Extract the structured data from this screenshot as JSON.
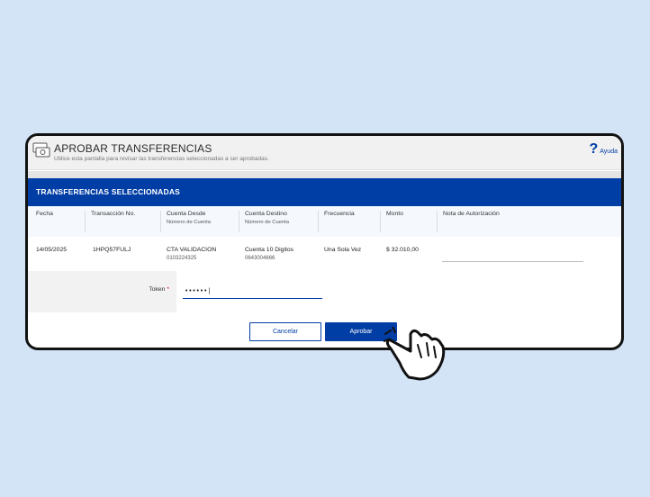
{
  "header": {
    "title": "APROBAR TRANSFERENCIAS",
    "subtitle": "Utilice esta pantalla para revisar las transferencias seleccionadas a ser aprobadas.",
    "help_label": "Ayuda",
    "icon": "money-transfer-icon"
  },
  "section": {
    "title": "TRANSFERENCIAS SELECCIONADAS"
  },
  "table": {
    "columns": [
      {
        "label": "Fecha"
      },
      {
        "label": "Transacción No."
      },
      {
        "label": "Cuenta Desde",
        "sub": "Número de Cuenta"
      },
      {
        "label": "Cuenta Destino",
        "sub": "Número de Cuenta"
      },
      {
        "label": "Frecuencia"
      },
      {
        "label": "Monto"
      },
      {
        "label": "Nota de Autorización"
      }
    ],
    "rows": [
      {
        "fecha": "14/05/2025",
        "transaccion": "1HPQ57FULJ",
        "cuenta_desde": "CTA VALIDACION",
        "cuenta_desde_num": "0103224325",
        "cuenta_destino": "Cuenta 10 Digitos",
        "cuenta_destino_num": "0643004666",
        "frecuencia": "Una Sola Vez",
        "monto": "$ 32.010,00",
        "nota": ""
      }
    ]
  },
  "token": {
    "label": "Token",
    "required_mark": "*",
    "value": "••••••|"
  },
  "buttons": {
    "cancel": "Cancelar",
    "approve": "Aprobar"
  },
  "colors": {
    "primary": "#003da5",
    "background": "#d3e4f7",
    "required": "#d0021b"
  }
}
